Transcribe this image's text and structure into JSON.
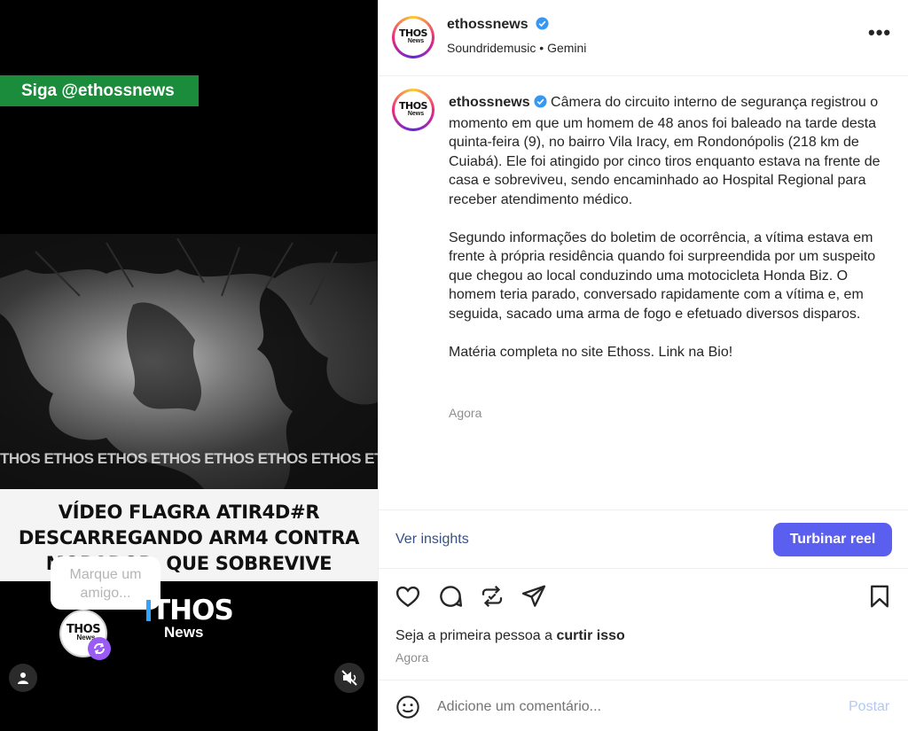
{
  "media": {
    "follow_banner": "Siga @ethossnews",
    "watermark": "THOS ETHOS ETHOS ETHOS ETHOS ETHOS ETHOS ETHOS",
    "headline": [
      "VÍDEO FLAGRA ATIR4D#R",
      "DESCARREGANDO ARM4 CONTRA",
      "MORADOR, QUE SOBREVIVE"
    ],
    "tag_prompt": "Marque um amigo...",
    "brand_logo_big": "THOS",
    "brand_logo_small": "News",
    "avatar_logo": "THOS",
    "avatar_logo_sub": "News",
    "icons": {
      "user_tag": "user-icon",
      "mute": "speaker-muted-icon",
      "remix": "remix-icon"
    }
  },
  "post": {
    "header": {
      "logo_text": "THOS",
      "logo_sub": "News",
      "username": "ethossnews",
      "subtitle": "Soundridemusic • Gemini",
      "more_icon": "more-horizontal-icon"
    },
    "caption": {
      "username": "ethossnews",
      "paragraphs": [
        "Câmera do circuito interno de segurança registrou o momento em que um homem de 48 anos foi baleado na tarde desta quinta-feira (9), no bairro Vila Iracy, em Rondonópolis (218 km de Cuiabá). Ele foi atingido por cinco tiros enquanto estava na frente de casa e sobreviveu, sendo encaminhado ao Hospital Regional para receber atendimento médico.",
        "Segundo informações do boletim de ocorrência, a vítima estava em frente à própria residência quando foi surpreendida por um suspeito que chegou ao local conduzindo uma motocicleta Honda Biz. O homem teria parado, conversado rapidamente com a vítima e, em seguida, sacado uma arma de fogo e efetuado diversos disparos.",
        "Matéria completa no site Ethoss. Link na Bio!"
      ],
      "time": "Agora"
    },
    "insights_link": "Ver insights",
    "boost_button": "Turbinar reel",
    "likes_prefix": "Seja a primeira pessoa a ",
    "likes_action": "curtir isso",
    "time": "Agora",
    "comment": {
      "placeholder": "Adicione um comentário...",
      "value": "",
      "post_label": "Postar"
    },
    "accent_color": "#5b5ff0",
    "link_color": "#385185",
    "verified_color": "#3897f0"
  }
}
